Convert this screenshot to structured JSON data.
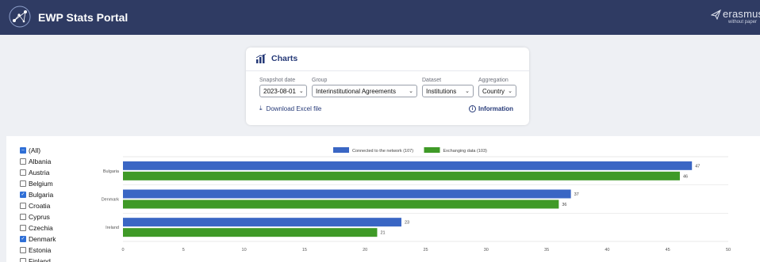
{
  "header": {
    "app_title": "EWP Stats Portal",
    "brand_name": "erasmus",
    "brand_tagline": "without paper",
    "bg_color": "#2f3b63"
  },
  "charts_card": {
    "title": "Charts",
    "icon": "bar-chart-icon",
    "filters": {
      "snapshot_date": {
        "label": "Snapshot date",
        "value": "2023-08-01"
      },
      "group": {
        "label": "Group",
        "value": "Interinstitutional Agreements"
      },
      "dataset": {
        "label": "Dataset",
        "value": "Institutions"
      },
      "aggregation": {
        "label": "Aggregation",
        "value": "Country"
      }
    },
    "download_label": "Download Excel file",
    "information_label": "Information"
  },
  "country_filter": {
    "items": [
      {
        "label": "(All)",
        "state": "partial"
      },
      {
        "label": "Albania",
        "state": "unchecked"
      },
      {
        "label": "Austria",
        "state": "unchecked"
      },
      {
        "label": "Belgium",
        "state": "unchecked"
      },
      {
        "label": "Bulgaria",
        "state": "checked"
      },
      {
        "label": "Croatia",
        "state": "unchecked"
      },
      {
        "label": "Cyprus",
        "state": "unchecked"
      },
      {
        "label": "Czechia",
        "state": "unchecked"
      },
      {
        "label": "Denmark",
        "state": "checked"
      },
      {
        "label": "Estonia",
        "state": "unchecked"
      },
      {
        "label": "Finland",
        "state": "unchecked"
      }
    ]
  },
  "chart_data": {
    "type": "bar",
    "orientation": "horizontal",
    "categories": [
      "Bulgaria",
      "Denmark",
      "Ireland"
    ],
    "series": [
      {
        "name": "Connected to the network (107)",
        "values": [
          47,
          37,
          23
        ],
        "color": "#3a66c4"
      },
      {
        "name": "Exchanging data (103)",
        "values": [
          46,
          36,
          21
        ],
        "color": "#3f9a27"
      }
    ],
    "xlim": [
      0,
      50
    ],
    "xticks": [
      0,
      5,
      10,
      15,
      20,
      25,
      30,
      35,
      40,
      45,
      50
    ],
    "legend_position": "top-center",
    "grid": true
  }
}
